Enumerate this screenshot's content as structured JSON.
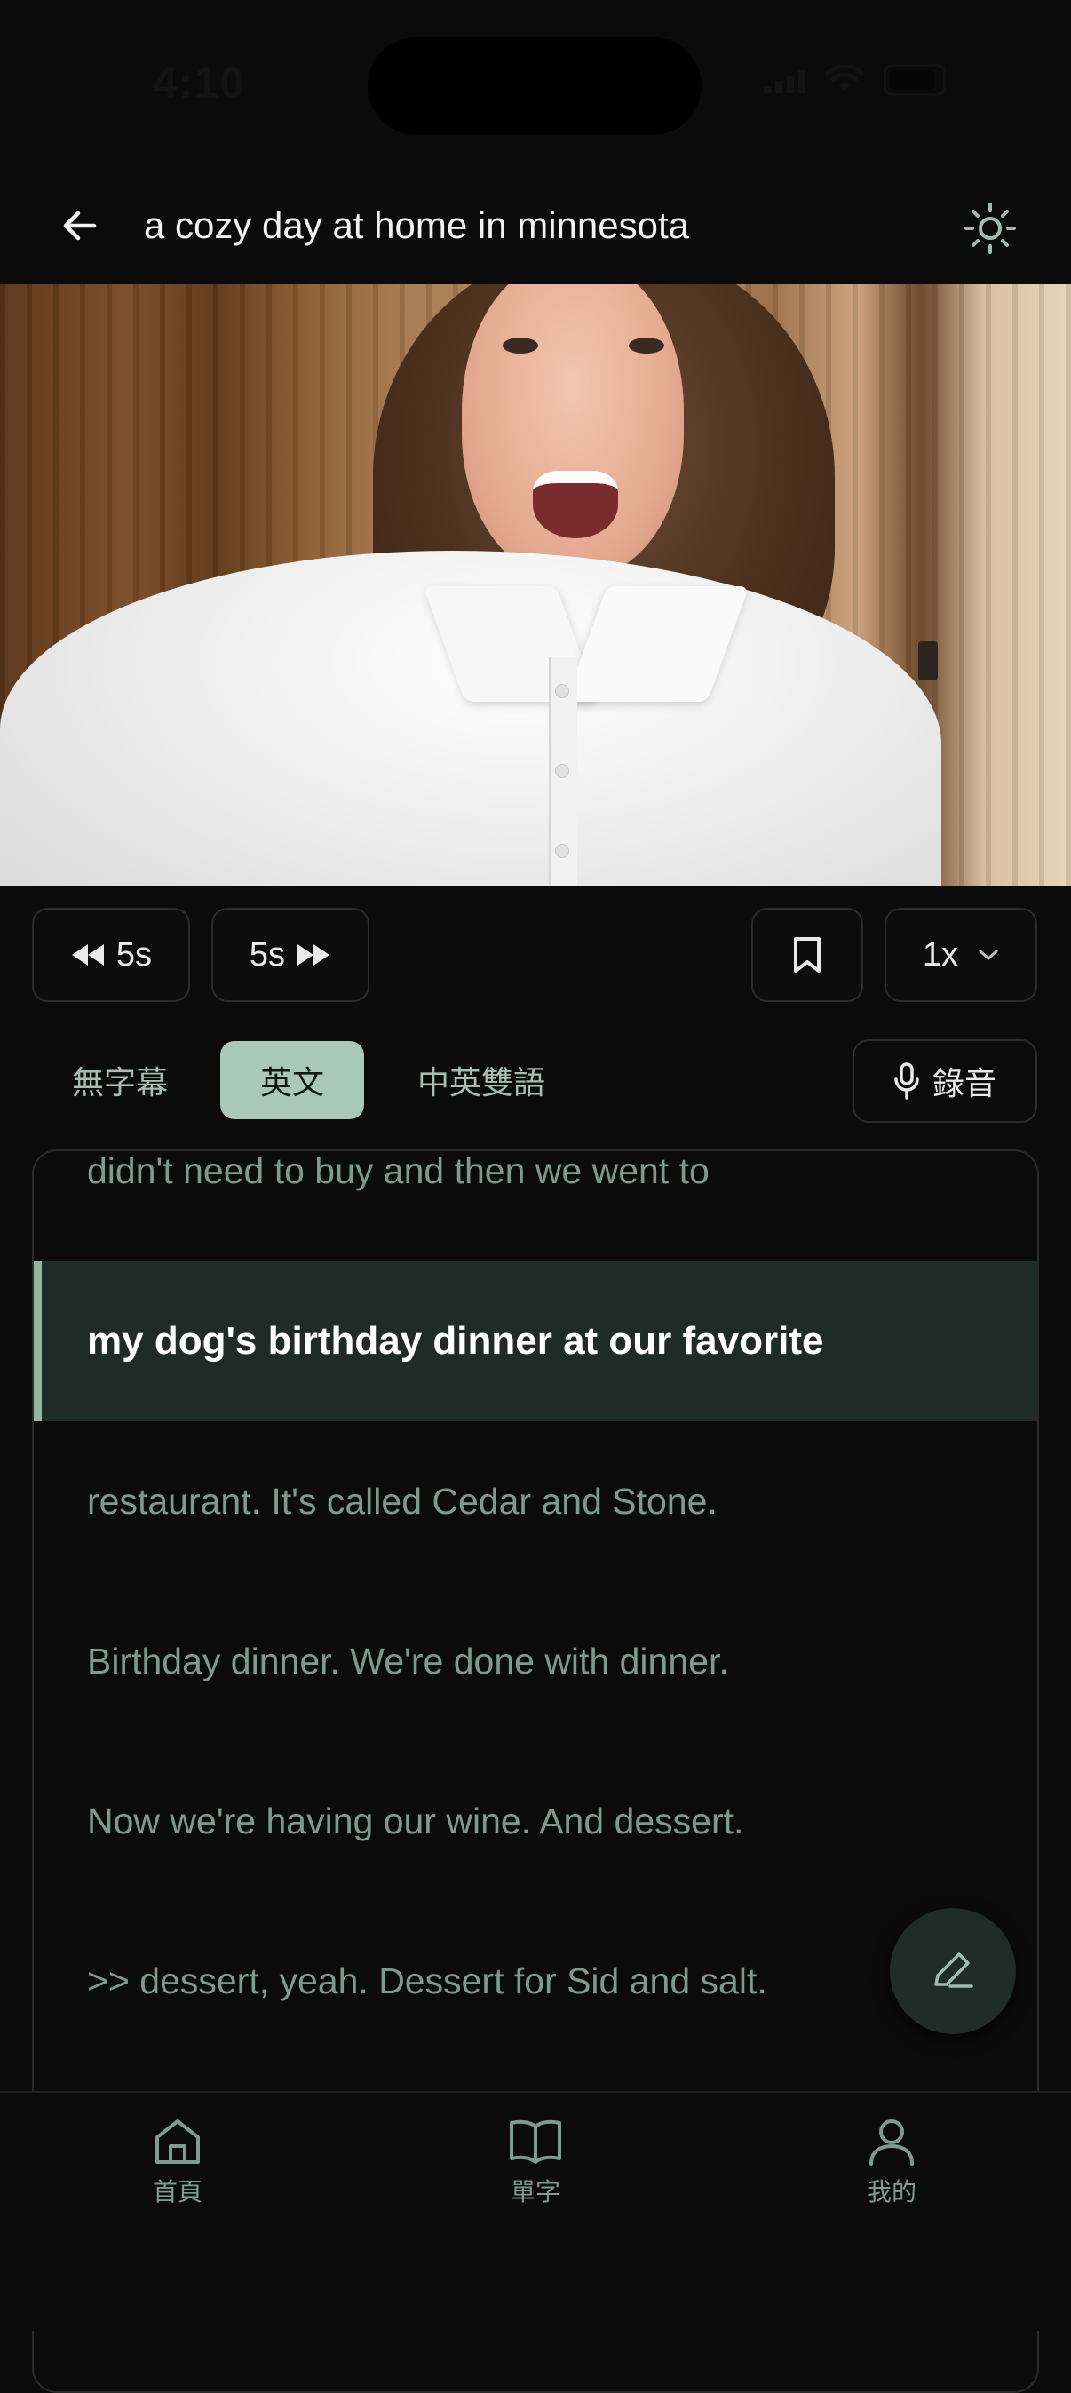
{
  "status_bar": {
    "time": "4:10"
  },
  "header": {
    "title": "a cozy day at home in minnesota",
    "back_icon": "arrow-left-icon",
    "theme_icon": "sun-icon"
  },
  "controls": {
    "rewind_label": "5s",
    "forward_label": "5s",
    "speed_label": "1x"
  },
  "subtitle_tabs": [
    {
      "label": "無字幕",
      "selected": false
    },
    {
      "label": "英文",
      "selected": true
    },
    {
      "label": "中英雙語",
      "selected": false
    }
  ],
  "record_label": "錄音",
  "transcript": [
    {
      "text": "didn't need to buy and then we went to",
      "active": false
    },
    {
      "text": "my dog's birthday dinner at our favorite",
      "active": true
    },
    {
      "text": "restaurant. It's called Cedar and Stone.",
      "active": false
    },
    {
      "text": "Birthday dinner. We're done with dinner.",
      "active": false
    },
    {
      "text": "Now we're having our wine. And dessert.",
      "active": false
    },
    {
      "text": ">> dessert, yeah. Dessert for Sid and salt.",
      "active": false
    }
  ],
  "bottom_nav": [
    {
      "label": "首頁",
      "icon": "home-icon"
    },
    {
      "label": "單字",
      "icon": "book-icon"
    },
    {
      "label": "我的",
      "icon": "user-icon"
    }
  ],
  "colors": {
    "background": "#0b0b0b",
    "accent": "#a9c8b9",
    "active_row": "#1e2b27",
    "muted_text": "#7e9a8c"
  }
}
